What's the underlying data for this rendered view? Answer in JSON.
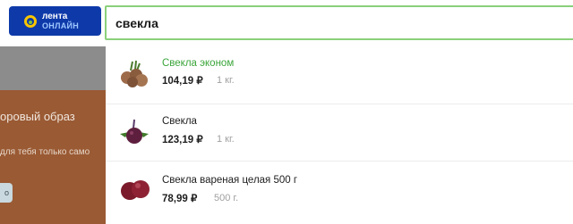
{
  "header": {
    "logo": {
      "line1": "лента",
      "line2": "ОНЛАЙН"
    },
    "search": {
      "value": "свекла"
    }
  },
  "background": {
    "promo_title": "оровый образ",
    "promo_subtitle": "для тебя только само",
    "promo_button": "о"
  },
  "suggestions": [
    {
      "name": "Свекла эконом",
      "price": "104,19 ₽",
      "unit": "1 кг.",
      "highlighted": true,
      "image_icon": "beets-bunch-icon"
    },
    {
      "name": "Свекла",
      "price": "123,19 ₽",
      "unit": "1 кг.",
      "highlighted": false,
      "image_icon": "beet-with-leaves-icon"
    },
    {
      "name": "Свекла вареная целая 500 г",
      "price": "78,99 ₽",
      "unit": "500 г.",
      "highlighted": false,
      "image_icon": "boiled-beets-icon"
    }
  ],
  "colors": {
    "brand_blue": "#0e3aa9",
    "search_border": "#8ad07a",
    "highlight_green": "#3aa53a",
    "backdrop": "#8c8c8c"
  }
}
